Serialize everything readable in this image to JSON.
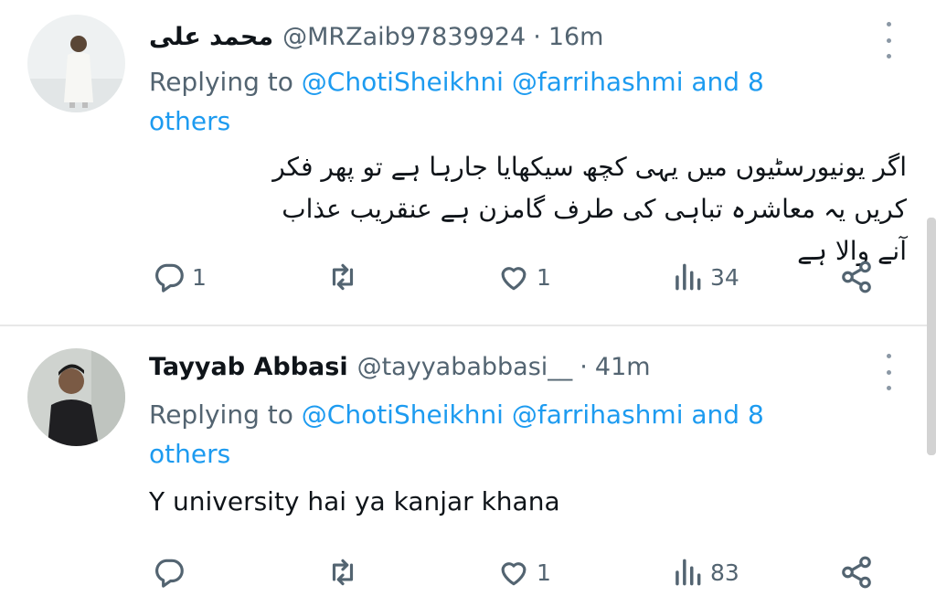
{
  "tweets": [
    {
      "name": "محمد علی",
      "handle": "@MRZaib97839924",
      "separator": "·",
      "time": "16m",
      "replying_prefix": "Replying to",
      "mentions": "@ChotiSheikhni @farrihashmi and 8 others",
      "text": "اگر یونیورسٹیوں میں یہی کچھ سیکھایا جارہا ہے تو پھر فکر کریں یہ معاشرہ تباہی کی طرف گامزن ہے عنقریب عذاب آنے والا ہے",
      "replies": "1",
      "retweets": "",
      "likes": "1",
      "views": "34"
    },
    {
      "name": "Tayyab Abbasi",
      "handle": "@tayyababbasi__",
      "separator": "·",
      "time": "41m",
      "replying_prefix": "Replying to",
      "mentions": "@ChotiSheikhni @farrihashmi and 8 others",
      "text": "Y university hai ya kanjar khana",
      "replies": "",
      "retweets": "",
      "likes": "1",
      "views": "83"
    }
  ],
  "icons": {
    "reply": "reply-icon",
    "retweet": "retweet-icon",
    "like": "heart-icon",
    "views": "views-icon",
    "share": "share-icon",
    "more": "more-vertical-icon"
  },
  "colors": {
    "link": "#1d9bf0",
    "secondary_text": "#536471",
    "primary_text": "#0f1419"
  }
}
